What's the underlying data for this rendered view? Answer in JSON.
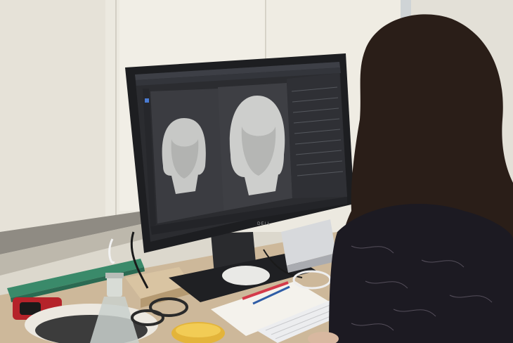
{
  "scene": {
    "description_tag": "photo-office-3d-modeling",
    "monitor": {
      "brand_text": "DELL",
      "screen": {
        "app": "3d-modeling-software",
        "viewports": [
          {
            "subject": "head-model"
          },
          {
            "subject": "head-model"
          }
        ]
      }
    }
  },
  "colors": {
    "wall": "#e9e6dc",
    "blind": "#f0ede4",
    "desk": "#cdb89a",
    "monitor_bezel": "#1d1e21",
    "screen_bg": "#2b2c30",
    "viewport_bg": "#3a3b40",
    "model_gray": "#c9cac8",
    "hair": "#2a1e18",
    "shirt": "#1c1a22"
  }
}
